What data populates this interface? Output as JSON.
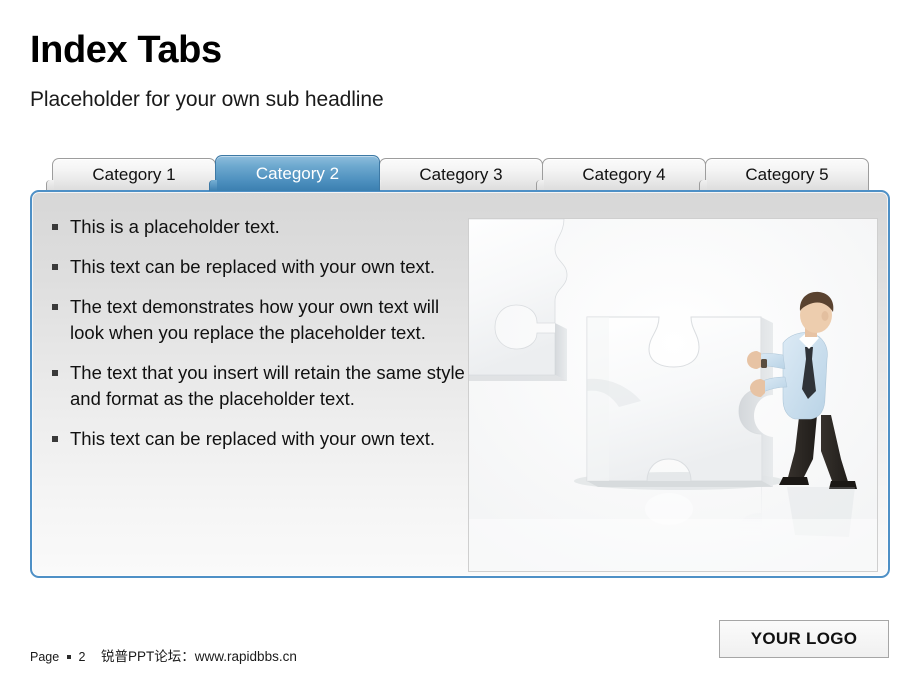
{
  "header": {
    "title": "Index Tabs",
    "subtitle": "Placeholder for your own sub headline"
  },
  "tabs": {
    "active_index": 1,
    "items": [
      {
        "label": "Category 1"
      },
      {
        "label": "Category 2"
      },
      {
        "label": "Category 3"
      },
      {
        "label": "Category 4"
      },
      {
        "label": "Category 5"
      }
    ]
  },
  "content": {
    "bullets": [
      {
        "text": "This is a placeholder text."
      },
      {
        "text": "This text can be replaced with your own text."
      },
      {
        "text": "The text demonstrates how your own text will look when you replace the placeholder text."
      },
      {
        "text": "The text that you insert will retain the same style and format as the placeholder text."
      },
      {
        "text": "This text can be replaced with your own text."
      }
    ],
    "image": {
      "name": "businessman-pushing-puzzle-piece",
      "description": "Businessman in light blue shirt and dark trousers pushing a large white jigsaw puzzle piece on a reflective white floor"
    }
  },
  "footer": {
    "page_label": "Page",
    "page_number": "2",
    "site": "锐普PPT论坛：www.rapidbbs.cn",
    "logo": "YOUR LOGO"
  },
  "colors": {
    "accent_blue": "#4e90c6",
    "active_tab_top": "#8ebddd",
    "active_tab_bottom": "#3b7fb0",
    "panel_top": "#d7d7d7",
    "panel_bottom": "#fafafa",
    "text": "#111111",
    "shirt_blue": "#c6dced",
    "trousers_dark": "#2b2723"
  }
}
